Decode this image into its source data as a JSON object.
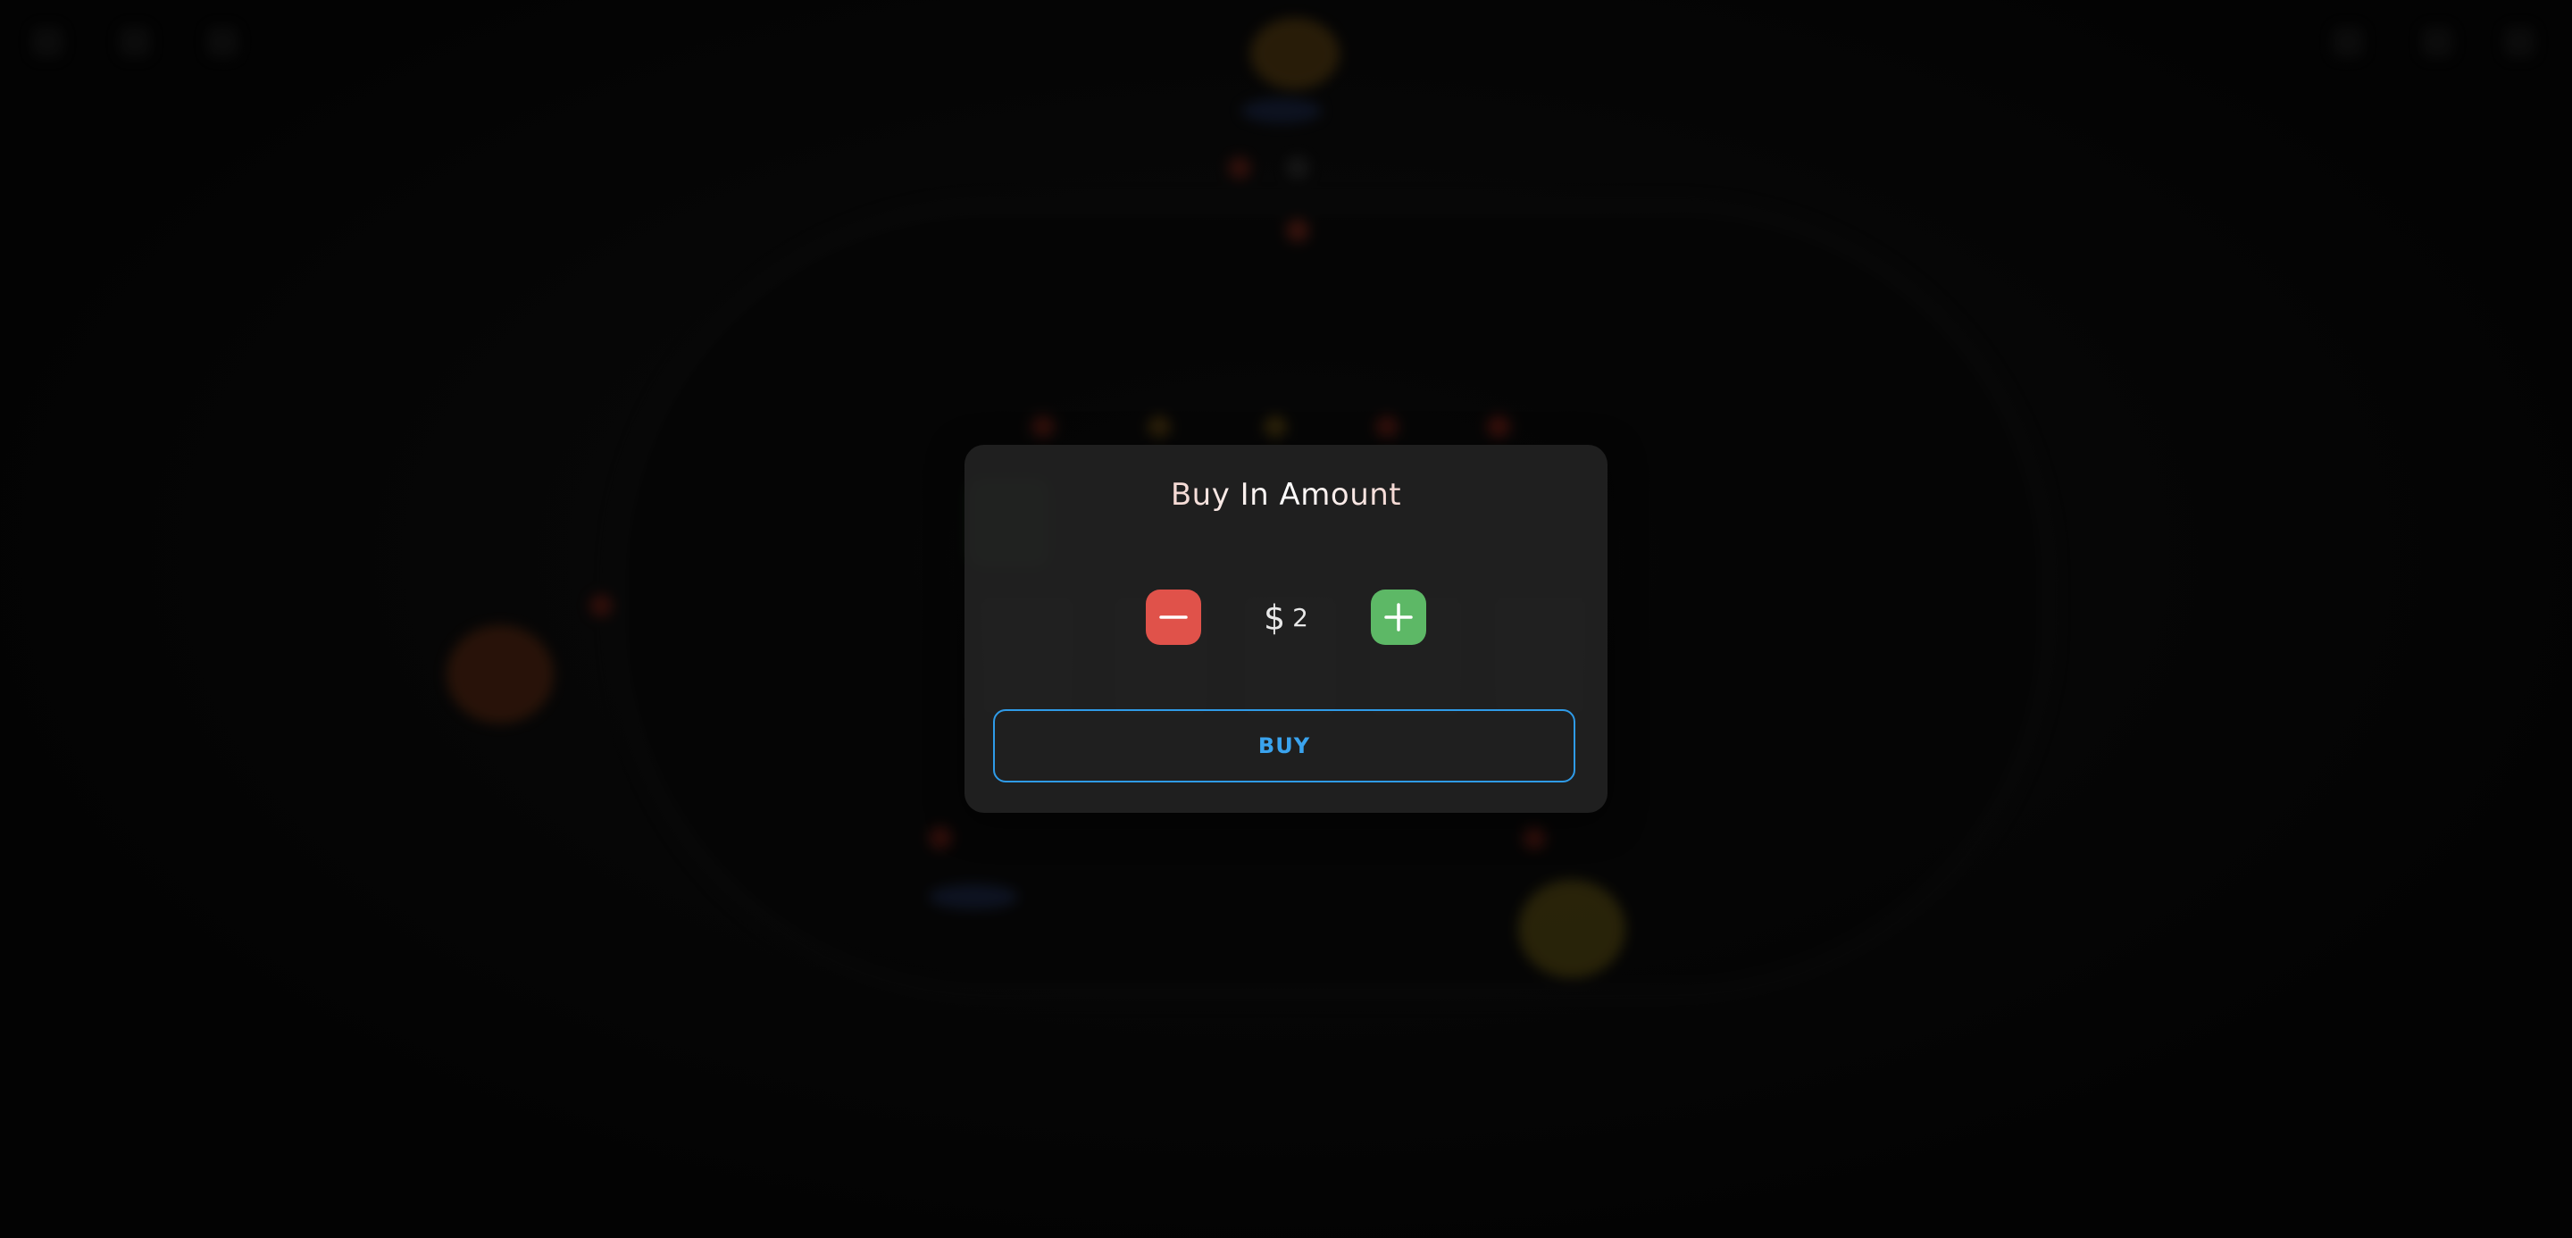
{
  "modal": {
    "title": "Buy In Amount",
    "currency": "$",
    "amount": "2",
    "buy_label": "BUY",
    "decrement_icon": "minus-icon",
    "increment_icon": "plus-icon"
  },
  "colors": {
    "decrement": "#e0524a",
    "increment": "#5db866",
    "buy_accent": "#3aa3ee",
    "title_accent": "#f0a49a"
  }
}
